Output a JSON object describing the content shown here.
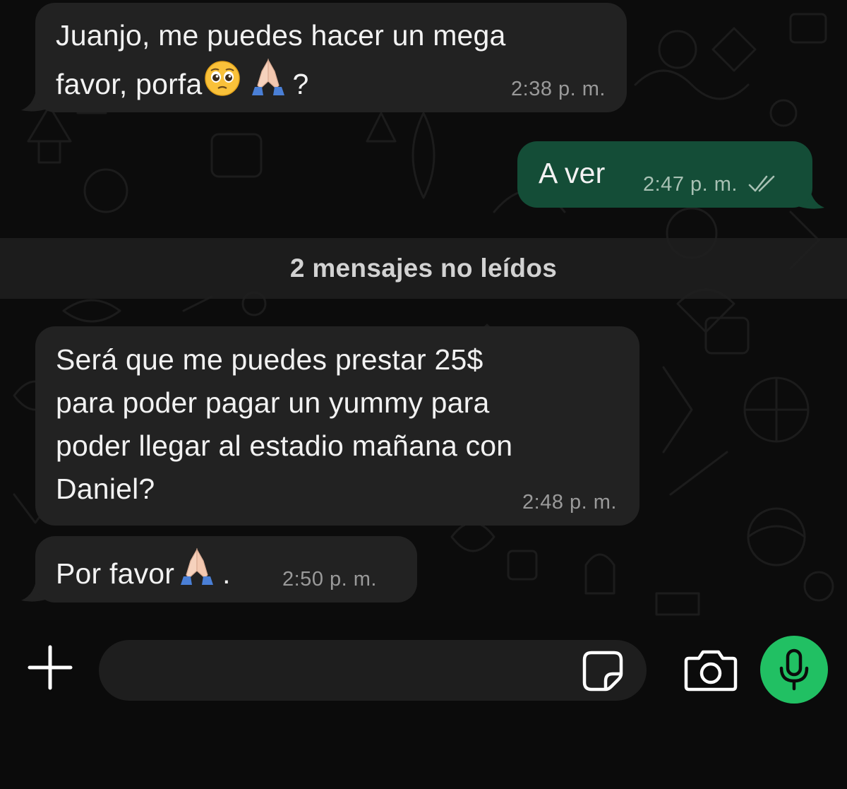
{
  "messages": [
    {
      "direction": "incoming",
      "line1": "Juanjo, me puedes hacer un mega",
      "line2_text": "favor, porfa",
      "line2_end": "?",
      "time": "2:38 p. m."
    },
    {
      "direction": "outgoing",
      "text": "A ver",
      "time": "2:47 p. m.",
      "status": "read-double-check-icon"
    },
    {
      "direction": "incoming",
      "lines": [
        "Será que me puedes prestar 25$",
        "para poder pagar un yummy para",
        "poder llegar al estadio mañana con",
        "Daniel?"
      ],
      "time": "2:48 p. m."
    },
    {
      "direction": "incoming",
      "text": "Por favor",
      "text_end": ".",
      "time": "2:50 p. m."
    }
  ],
  "unread_divider": "2 mensajes no leídos",
  "composer": {
    "placeholder": "",
    "icons": [
      "plus-icon",
      "sticker-icon",
      "camera-icon",
      "microphone-icon"
    ]
  },
  "colors": {
    "background": "#0c0c0c",
    "incoming_bubble": "#222222",
    "outgoing_bubble": "#144d37",
    "mic_button": "#21c063"
  }
}
